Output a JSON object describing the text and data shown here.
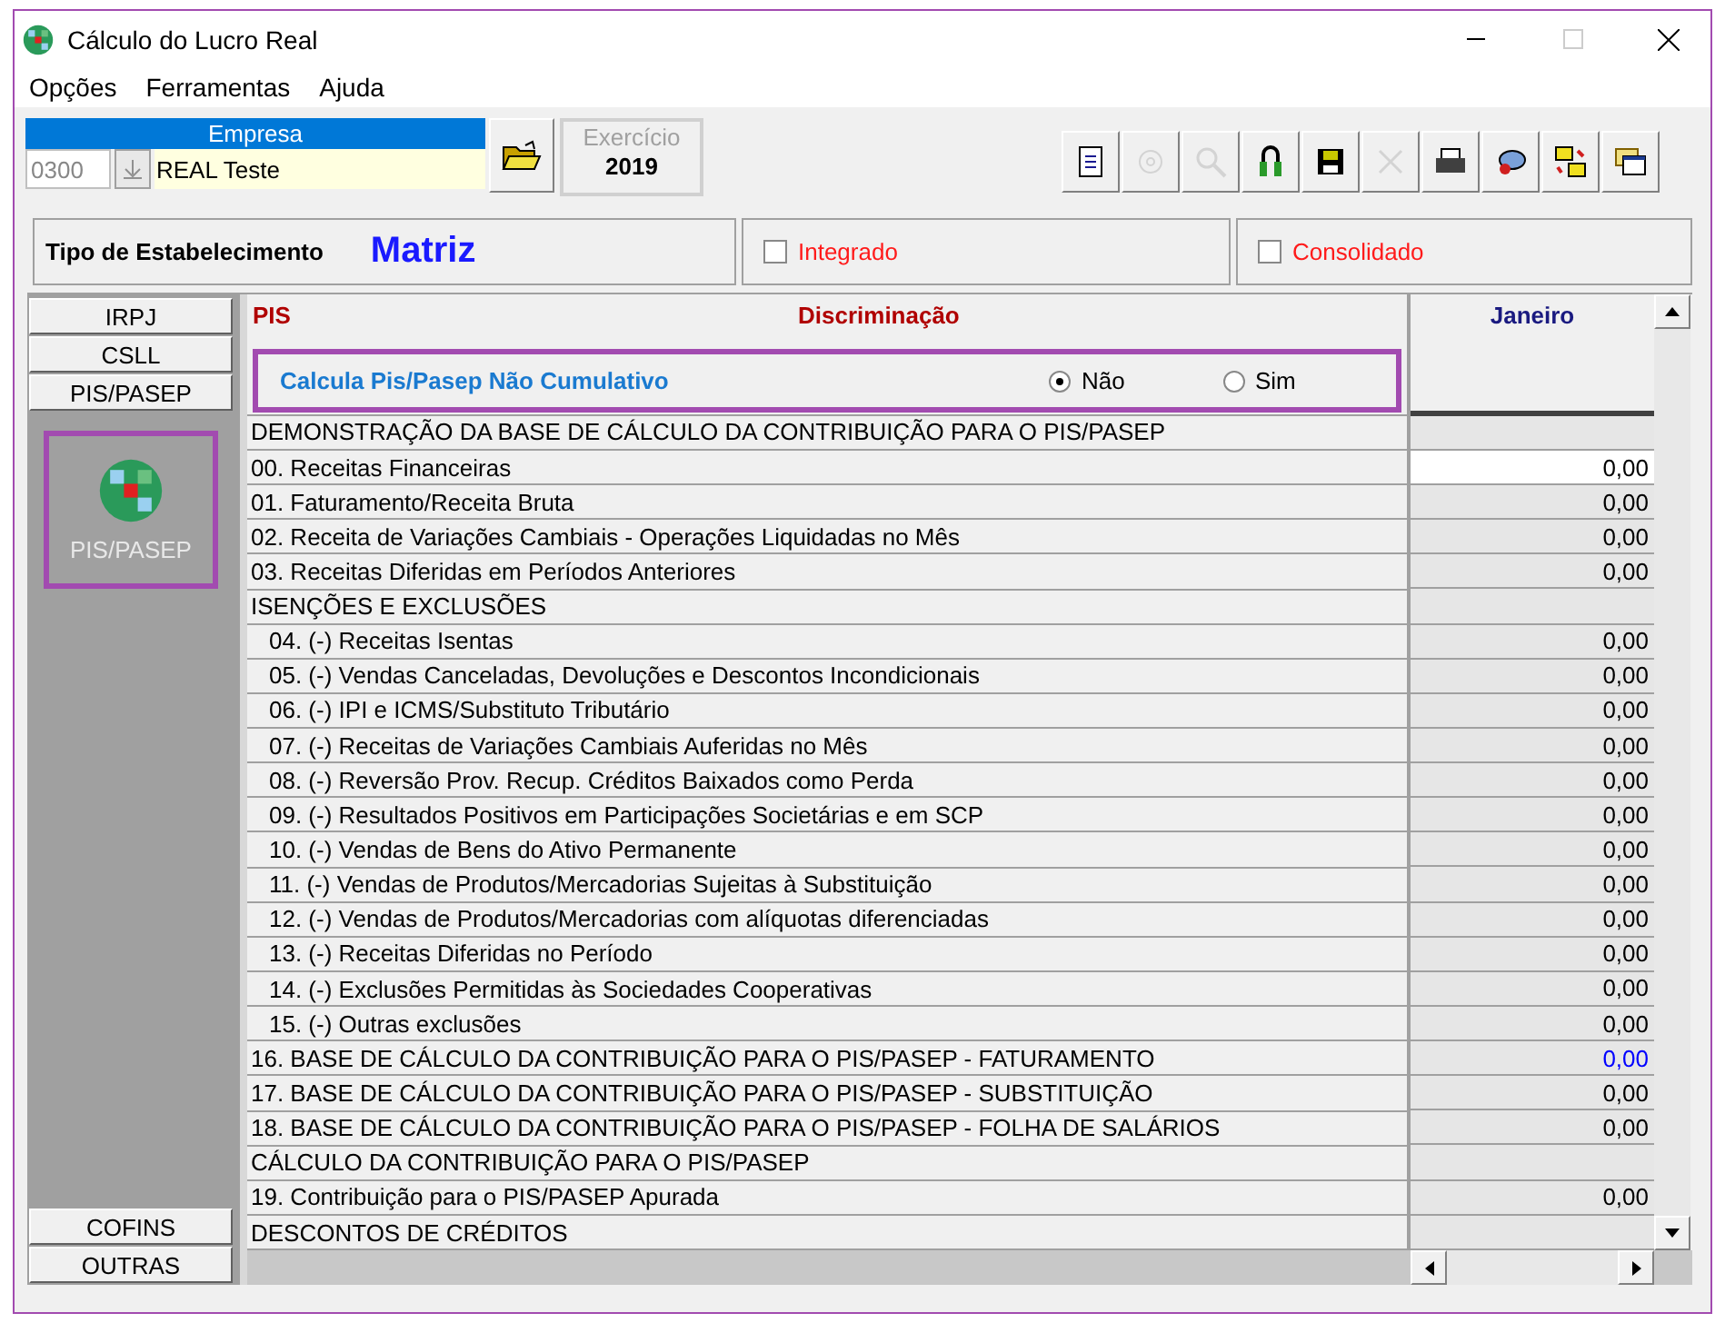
{
  "window": {
    "title": "Cálculo do Lucro Real"
  },
  "menu": [
    "Opções",
    "Ferramentas",
    "Ajuda"
  ],
  "empresa": {
    "label": "Empresa",
    "code": "0300",
    "name": "REAL Teste"
  },
  "exercicio": {
    "label": "Exercício",
    "year": "2019"
  },
  "toolbar": [
    {
      "kind": "document",
      "disabled": false
    },
    {
      "kind": "gear",
      "disabled": true
    },
    {
      "kind": "search",
      "disabled": true
    },
    {
      "kind": "lock",
      "disabled": false
    },
    {
      "kind": "save",
      "disabled": false
    },
    {
      "kind": "delete",
      "disabled": true
    },
    {
      "kind": "print",
      "disabled": false
    },
    {
      "kind": "mouse",
      "disabled": false
    },
    {
      "kind": "folders",
      "disabled": false
    },
    {
      "kind": "window",
      "disabled": false
    }
  ],
  "establishment": {
    "label": "Tipo de Estabelecimento",
    "value": "Matriz"
  },
  "options": [
    {
      "label": "Integrado",
      "checked": false
    },
    {
      "label": "Consolidado",
      "checked": false
    }
  ],
  "sidebar": {
    "top_tabs": [
      "IRPJ",
      "CSLL",
      "PIS/PASEP"
    ],
    "panel_item": "PIS/PASEP",
    "bottom_tabs": [
      "COFINS",
      "OUTRAS"
    ]
  },
  "table": {
    "title": "PIS",
    "column_header": "Discriminação",
    "month": "Janeiro",
    "question": {
      "label": "Calcula Pis/Pasep Não Cumulativo",
      "choices": [
        {
          "label": "Não",
          "selected": true
        },
        {
          "label": "Sim",
          "selected": false
        }
      ]
    },
    "rows": [
      {
        "kind": "section",
        "label": "DEMONSTRAÇÃO DA BASE DE CÁLCULO DA CONTRIBUIÇÃO PARA O PIS/PASEP"
      },
      {
        "kind": "item",
        "label": "00. Receitas Financeiras",
        "value": "0,00",
        "selected": true,
        "color": "#000000"
      },
      {
        "kind": "item",
        "label": "01. Faturamento/Receita Bruta",
        "value": "0,00",
        "selected": false,
        "color": "#000000"
      },
      {
        "kind": "item",
        "label": "02. Receita de Variações Cambiais - Operações Liquidadas no Mês",
        "value": "0,00",
        "selected": false,
        "color": "#000000"
      },
      {
        "kind": "item",
        "label": "03. Receitas Diferidas em Períodos Anteriores",
        "value": "0,00",
        "selected": false,
        "color": "#000000"
      },
      {
        "kind": "section",
        "label": "ISENÇÕES E EXCLUSÕES"
      },
      {
        "kind": "subitem",
        "label": "04. (-) Receitas Isentas",
        "value": "0,00",
        "selected": false,
        "color": "#000000"
      },
      {
        "kind": "subitem",
        "label": "05. (-) Vendas Canceladas, Devoluções e Descontos Incondicionais",
        "value": "0,00",
        "selected": false,
        "color": "#000000"
      },
      {
        "kind": "subitem",
        "label": "06. (-) IPI e ICMS/Substituto Tributário",
        "value": "0,00",
        "selected": false,
        "color": "#000000"
      },
      {
        "kind": "subitem",
        "label": "07. (-) Receitas de Variações Cambiais Auferidas no Mês",
        "value": "0,00",
        "selected": false,
        "color": "#000000"
      },
      {
        "kind": "subitem",
        "label": "08. (-) Reversão Prov. Recup. Créditos Baixados como Perda",
        "value": "0,00",
        "selected": false,
        "color": "#000000"
      },
      {
        "kind": "subitem",
        "label": "09. (-) Resultados Positivos em Participações Societárias e em SCP",
        "value": "0,00",
        "selected": false,
        "color": "#000000"
      },
      {
        "kind": "subitem",
        "label": "10. (-) Vendas de Bens do Ativo Permanente",
        "value": "0,00",
        "selected": false,
        "color": "#000000"
      },
      {
        "kind": "subitem",
        "label": "11. (-) Vendas de Produtos/Mercadorias Sujeitas à Substituição",
        "value": "0,00",
        "selected": false,
        "color": "#000000"
      },
      {
        "kind": "subitem",
        "label": "12. (-) Vendas de Produtos/Mercadorias com alíquotas diferenciadas",
        "value": "0,00",
        "selected": false,
        "color": "#000000"
      },
      {
        "kind": "subitem",
        "label": "13. (-) Receitas Diferidas no Período",
        "value": "0,00",
        "selected": false,
        "color": "#000000"
      },
      {
        "kind": "subitem",
        "label": "14. (-) Exclusões Permitidas às Sociedades Cooperativas",
        "value": "0,00",
        "selected": false,
        "color": "#000000"
      },
      {
        "kind": "subitem",
        "label": "15. (-) Outras exclusões",
        "value": "0,00",
        "selected": false,
        "color": "#000000"
      },
      {
        "kind": "item",
        "label": "16. BASE DE CÁLCULO DA CONTRIBUIÇÃO PARA O PIS/PASEP - FATURAMENTO",
        "value": "0,00",
        "selected": false,
        "color": "#0000ff"
      },
      {
        "kind": "item",
        "label": "17. BASE DE CÁLCULO DA CONTRIBUIÇÃO PARA O PIS/PASEP - SUBSTITUIÇÃO",
        "value": "0,00",
        "selected": false,
        "color": "#000000"
      },
      {
        "kind": "item",
        "label": "18. BASE DE CÁLCULO DA CONTRIBUIÇÃO PARA O PIS/PASEP - FOLHA DE SALÁRIOS",
        "value": "0,00",
        "selected": false,
        "color": "#000000"
      },
      {
        "kind": "section",
        "label": "CÁLCULO DA CONTRIBUIÇÃO PARA O PIS/PASEP"
      },
      {
        "kind": "item",
        "label": "19. Contribuição para o PIS/PASEP Apurada",
        "value": "0,00",
        "selected": false,
        "color": "#000000"
      },
      {
        "kind": "section",
        "label": "DESCONTOS DE CRÉDITOS"
      }
    ]
  }
}
